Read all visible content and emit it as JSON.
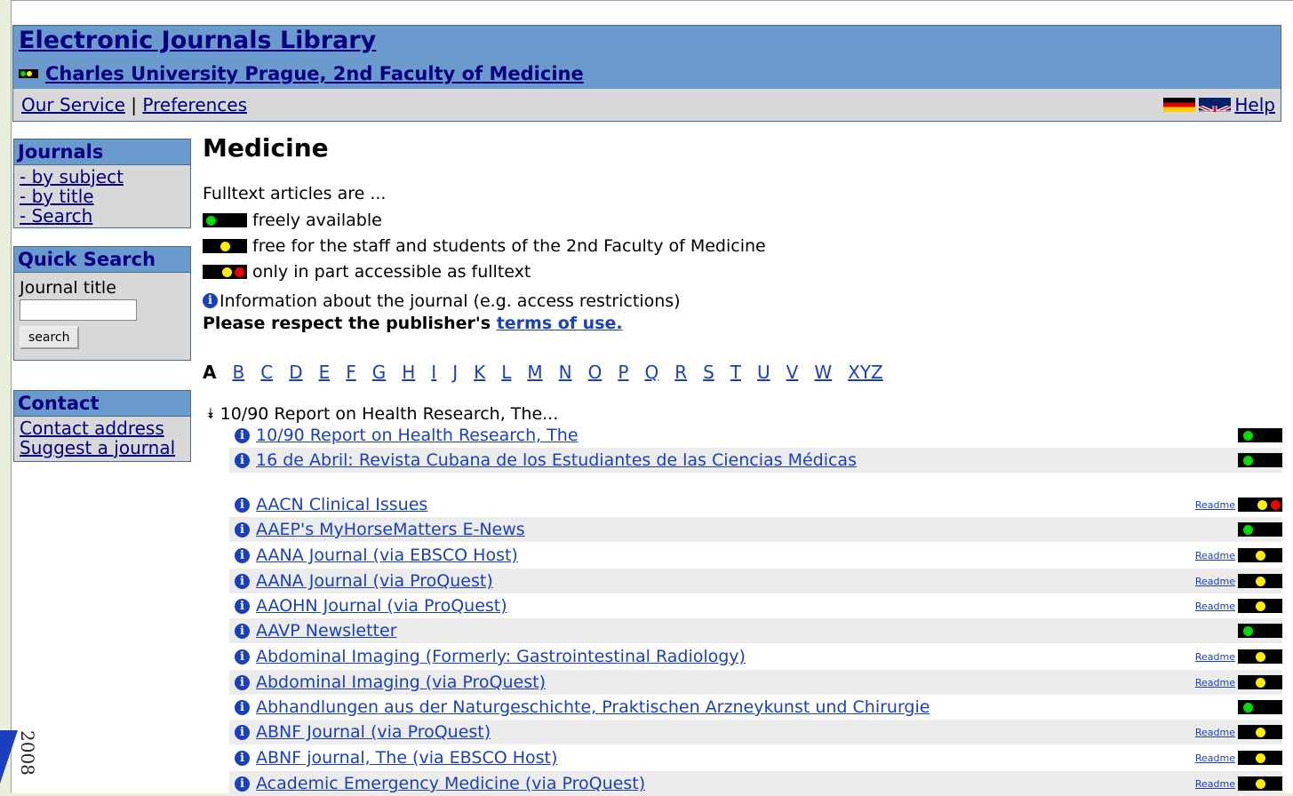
{
  "header": {
    "title": "Electronic Journals Library",
    "institution": "Charles University Prague, 2nd Faculty of Medicine"
  },
  "nav": {
    "our_service": "Our Service",
    "separator": "|",
    "preferences": "Preferences",
    "help": "Help"
  },
  "sidebar": {
    "journals": {
      "heading": "Journals",
      "items": [
        "- by subject",
        "- by title",
        "- Search"
      ]
    },
    "quick_search": {
      "heading": "Quick Search",
      "label": "Journal title",
      "input_value": "",
      "button": "search"
    },
    "contact": {
      "heading": "Contact",
      "items": [
        "Contact address",
        "Suggest a journal"
      ]
    }
  },
  "main": {
    "subject": "Medicine",
    "legend_intro": "Fulltext articles are ...",
    "legend": [
      {
        "lights": "green",
        "text": "freely available"
      },
      {
        "lights": "yellow",
        "text": "free for the staff and students of the 2nd Faculty of Medicine"
      },
      {
        "lights": "yellow-red",
        "text": "only in part accessible as fulltext"
      }
    ],
    "info_text": "Information about the journal (e.g. access restrictions)",
    "terms_prefix": "Please respect the publisher's",
    "terms_link": "terms of use.",
    "alphabet_current": "A",
    "alphabet": [
      "B",
      "C",
      "D",
      "E",
      "F",
      "G",
      "H",
      "I",
      "J",
      "K",
      "L",
      "M",
      "N",
      "O",
      "P",
      "Q",
      "R",
      "S",
      "T",
      "U",
      "V",
      "W",
      "XYZ"
    ],
    "group_label": "10/90 Report on Health Research, The...",
    "readme_label": "Readme",
    "journals": [
      {
        "title": "10/90 Report on Health Research, The",
        "status": "green",
        "readme": false
      },
      {
        "title": "16 de Abril: Revista Cubana de los Estudiantes de las Ciencias Médicas",
        "status": "green",
        "readme": false
      },
      {
        "title": "AACN Clinical Issues",
        "status": "yellow-red",
        "readme": true
      },
      {
        "title": "AAEP's MyHorseMatters E-News",
        "status": "green",
        "readme": false
      },
      {
        "title": "AANA Journal (via EBSCO Host)",
        "status": "yellow",
        "readme": true
      },
      {
        "title": "AANA Journal (via ProQuest)",
        "status": "yellow",
        "readme": true
      },
      {
        "title": "AAOHN Journal (via ProQuest)",
        "status": "yellow",
        "readme": true
      },
      {
        "title": "AAVP Newsletter",
        "status": "green",
        "readme": false
      },
      {
        "title": "Abdominal Imaging (Formerly: Gastrointestinal Radiology)",
        "status": "yellow",
        "readme": true
      },
      {
        "title": "Abdominal Imaging (via ProQuest)",
        "status": "yellow",
        "readme": true
      },
      {
        "title": "Abhandlungen aus der Naturgeschichte, Praktischen Arzneykunst und Chirurgie",
        "status": "green",
        "readme": false
      },
      {
        "title": "ABNF Journal (via ProQuest)",
        "status": "yellow",
        "readme": true
      },
      {
        "title": "ABNF journal, The (via EBSCO Host)",
        "status": "yellow",
        "readme": true
      },
      {
        "title": "Academic Emergency Medicine (via ProQuest)",
        "status": "yellow",
        "readme": true
      }
    ]
  },
  "logo_text": "2008",
  "colors": {
    "header_bg": "#6b9acd",
    "link": "#1a3fbf",
    "nav_link": "#000080",
    "green": "#00dd00",
    "yellow": "#ffee00",
    "red": "#ee0000"
  }
}
